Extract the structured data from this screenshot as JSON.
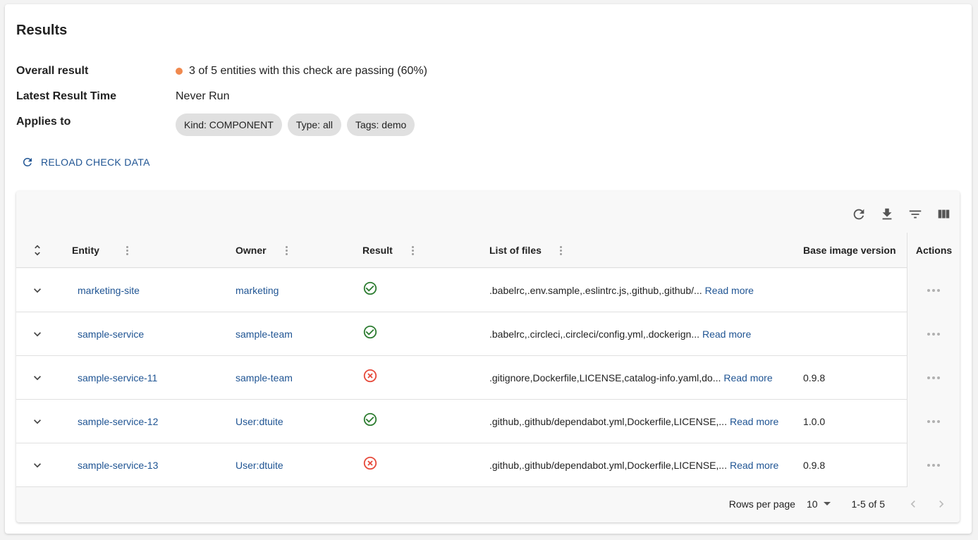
{
  "title": "Results",
  "summary": {
    "overall_label": "Overall result",
    "overall_value": "3 of 5 entities with this check are passing (60%)",
    "overall_status_color": "#f0894e",
    "latest_label": "Latest Result Time",
    "latest_value": "Never Run",
    "applies_label": "Applies to",
    "chips": [
      "Kind: COMPONENT",
      "Type: all",
      "Tags: demo"
    ]
  },
  "reload_label": "RELOAD CHECK DATA",
  "toolbar": [
    "refresh-icon",
    "download-icon",
    "filter-icon",
    "columns-icon"
  ],
  "columns": {
    "entity": "Entity",
    "owner": "Owner",
    "result": "Result",
    "files": "List of files",
    "base_image": "Base image version",
    "actions": "Actions"
  },
  "rows": [
    {
      "entity": "marketing-site",
      "owner": "marketing",
      "result": "pass",
      "files": ".babelrc,.env.sample,.eslintrc.js,.github,.github/...",
      "read_more": "Read more",
      "base_image": ""
    },
    {
      "entity": "sample-service",
      "owner": "sample-team",
      "result": "pass",
      "files": ".babelrc,.circleci,.circleci/config.yml,.dockerign...",
      "read_more": "Read more",
      "base_image": ""
    },
    {
      "entity": "sample-service-11",
      "owner": "sample-team",
      "result": "fail",
      "files": ".gitignore,Dockerfile,LICENSE,catalog-info.yaml,do...",
      "read_more": "Read more",
      "base_image": "0.9.8"
    },
    {
      "entity": "sample-service-12",
      "owner": "User:dtuite",
      "result": "pass",
      "files": ".github,.github/dependabot.yml,Dockerfile,LICENSE,...",
      "read_more": "Read more",
      "base_image": "1.0.0"
    },
    {
      "entity": "sample-service-13",
      "owner": "User:dtuite",
      "result": "fail",
      "files": ".github,.github/dependabot.yml,Dockerfile,LICENSE,...",
      "read_more": "Read more",
      "base_image": "0.9.8"
    }
  ],
  "colors": {
    "pass": "#2e7d32",
    "fail": "#e64a3b",
    "link": "#1f5493"
  },
  "footer": {
    "rows_per_page_label": "Rows per page",
    "rows_per_page_value": "10",
    "range": "1-5 of 5"
  }
}
